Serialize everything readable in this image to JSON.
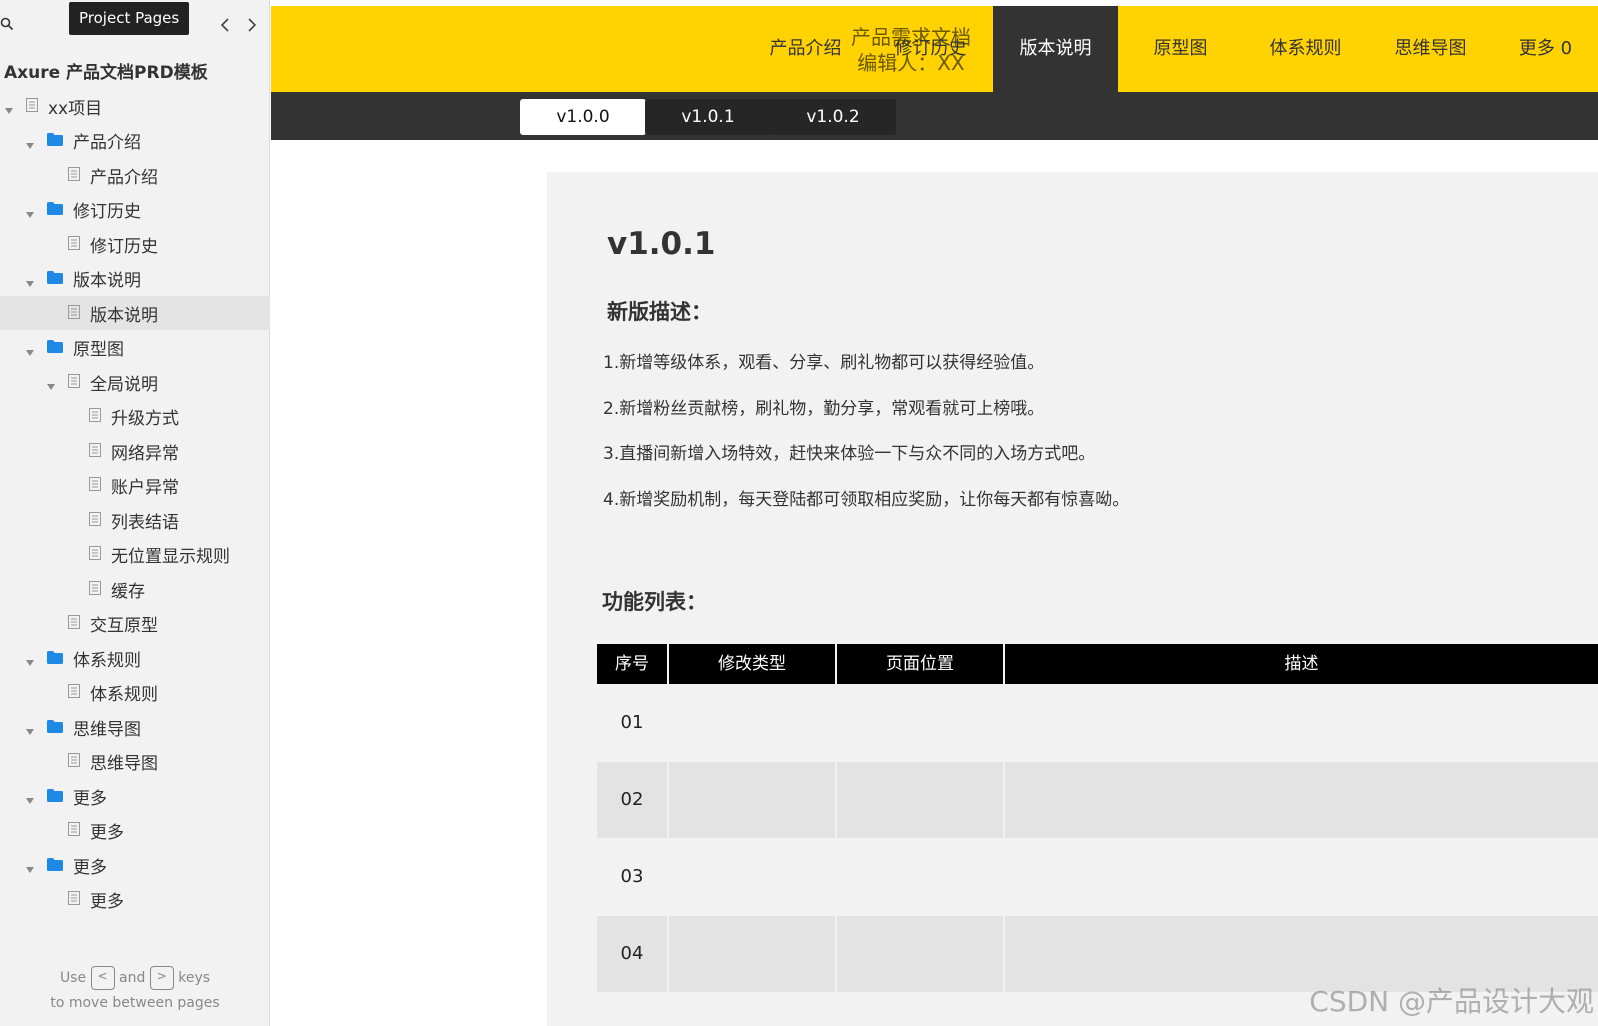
{
  "sidebar": {
    "tooltip": "Project Pages",
    "title": "Axure 产品文档PRD模板",
    "tree": [
      {
        "label": "xx项目",
        "level": 0,
        "type": "page",
        "caret": true
      },
      {
        "label": "产品介绍",
        "level": 1,
        "type": "folder",
        "caret": true
      },
      {
        "label": "产品介绍",
        "level": 2,
        "type": "page",
        "caret": false
      },
      {
        "label": "修订历史",
        "level": 1,
        "type": "folder",
        "caret": true
      },
      {
        "label": "修订历史",
        "level": 2,
        "type": "page",
        "caret": false
      },
      {
        "label": "版本说明",
        "level": 1,
        "type": "folder",
        "caret": true
      },
      {
        "label": "版本说明",
        "level": 2,
        "type": "page",
        "caret": false,
        "selected": true
      },
      {
        "label": "原型图",
        "level": 1,
        "type": "folder",
        "caret": true
      },
      {
        "label": "全局说明",
        "level": 2,
        "type": "page",
        "caret": true
      },
      {
        "label": "升级方式",
        "level": 3,
        "type": "page",
        "caret": false
      },
      {
        "label": "网络异常",
        "level": 3,
        "type": "page",
        "caret": false
      },
      {
        "label": "账户异常",
        "level": 3,
        "type": "page",
        "caret": false
      },
      {
        "label": "列表结语",
        "level": 3,
        "type": "page",
        "caret": false
      },
      {
        "label": "无位置显示规则",
        "level": 3,
        "type": "page",
        "caret": false
      },
      {
        "label": "缓存",
        "level": 3,
        "type": "page",
        "caret": false
      },
      {
        "label": "交互原型",
        "level": 2,
        "type": "page",
        "caret": false
      },
      {
        "label": "体系规则",
        "level": 1,
        "type": "folder",
        "caret": true
      },
      {
        "label": "体系规则",
        "level": 2,
        "type": "page",
        "caret": false
      },
      {
        "label": "思维导图",
        "level": 1,
        "type": "folder",
        "caret": true
      },
      {
        "label": "思维导图",
        "level": 2,
        "type": "page",
        "caret": false
      },
      {
        "label": "更多",
        "level": 1,
        "type": "folder",
        "caret": true
      },
      {
        "label": "更多",
        "level": 2,
        "type": "page",
        "caret": false
      },
      {
        "label": "更多",
        "level": 1,
        "type": "folder",
        "caret": true
      },
      {
        "label": "更多",
        "level": 2,
        "type": "page",
        "caret": false
      }
    ],
    "footer": {
      "use": "Use",
      "key_prev": "<",
      "and": "and",
      "key_next": ">",
      "keys": "keys",
      "line2": "to move between pages"
    }
  },
  "header": {
    "doc_title_line1": "产品需求文档",
    "doc_title_line2": "编辑人：XX",
    "nav": [
      {
        "label": "产品介绍",
        "active": false
      },
      {
        "label": "修订历史",
        "active": false
      },
      {
        "label": "版本说明",
        "active": true
      },
      {
        "label": "原型图",
        "active": false
      },
      {
        "label": "体系规则",
        "active": false
      },
      {
        "label": "思维导图",
        "active": false
      },
      {
        "label": "更多 0",
        "active": false
      }
    ],
    "versions": [
      {
        "label": "v1.0.0",
        "active": true
      },
      {
        "label": "v1.0.1",
        "active": false
      },
      {
        "label": "v1.0.2",
        "active": false
      }
    ]
  },
  "content": {
    "version_heading": "v1.0.1",
    "desc_heading": "新版描述：",
    "desc_lines": [
      "1.新增等级体系，观看、分享、刷礼物都可以获得经验值。",
      "2.新增粉丝贡献榜，刷礼物，勤分享，常观看就可上榜哦。",
      "3.直播间新增入场特效，赶快来体验一下与众不同的入场方式吧。",
      "4.新增奖励机制，每天登陆都可领取相应奖励，让你每天都有惊喜呦。"
    ],
    "func_heading": "功能列表：",
    "table": {
      "headers": [
        "序号",
        "修改类型",
        "页面位置",
        "描述"
      ],
      "rows": [
        "01",
        "02",
        "03",
        "04"
      ]
    }
  },
  "watermark": "CSDN @产品设计大观",
  "colors": {
    "header_yellow": "#ffd200",
    "header_dark": "#333333",
    "folder_blue": "#1e88e5"
  }
}
